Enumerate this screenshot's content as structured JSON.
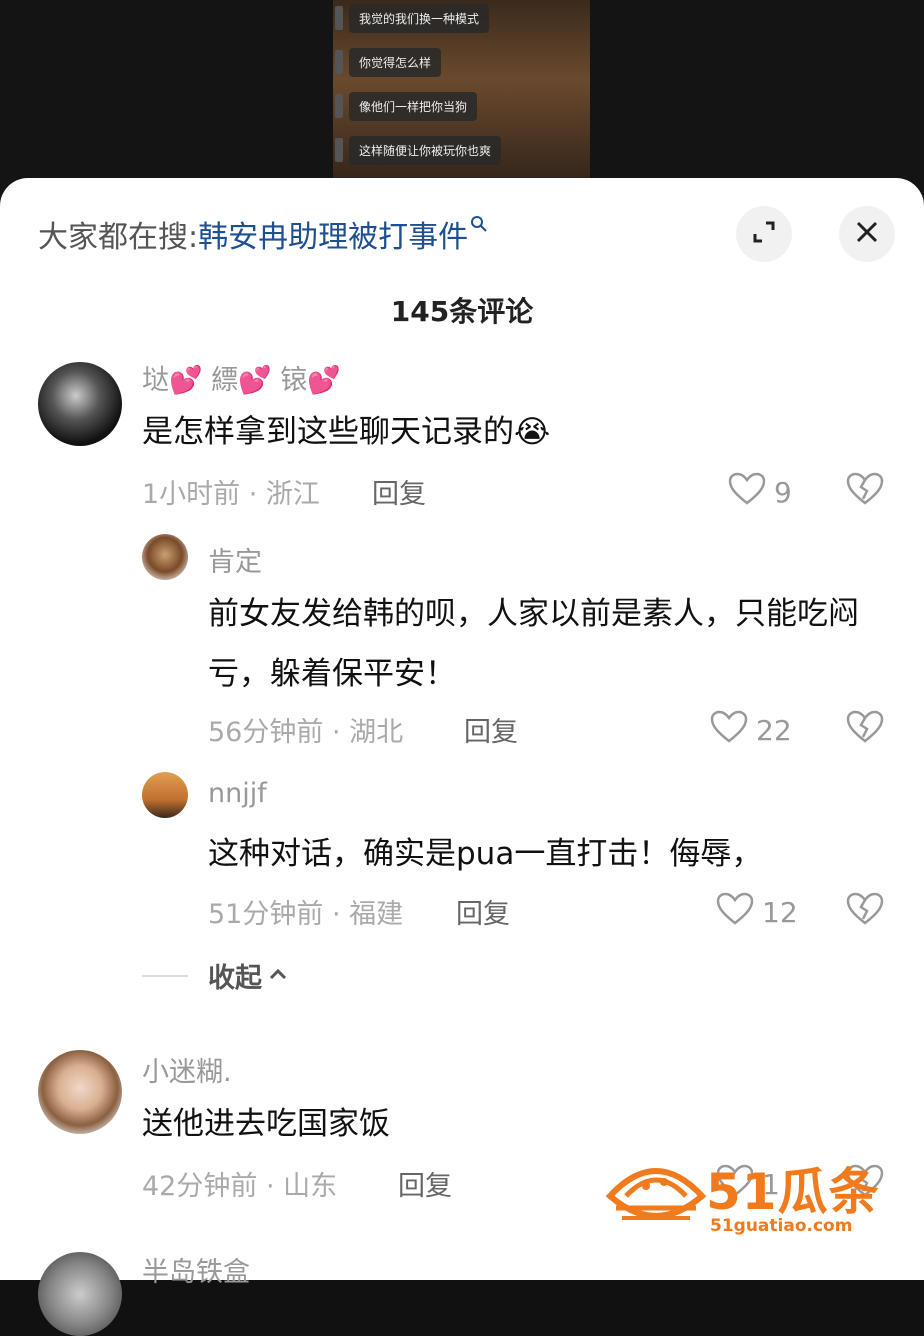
{
  "video": {
    "chat_lines": [
      "我觉的我们换一种模式",
      "你觉得怎么样",
      "像他们一样把你当狗",
      "这样随便让你被玩你也爽"
    ]
  },
  "header": {
    "search_prefix": "大家都在搜:",
    "search_query": "韩安冉助理被打事件",
    "comment_count": "145条评论"
  },
  "comments": [
    {
      "name": "垯💕 縹💕 锿💕",
      "text": "是怎样拿到这些聊天记录的😭",
      "meta": "1小时前 · 浙江",
      "reply": "回复",
      "likes": "9"
    },
    {
      "name": "肯定",
      "text": "前女友发给韩的呗，人家以前是素人，只能吃闷亏，躲着保平安！",
      "meta": "56分钟前 · 湖北",
      "reply": "回复",
      "likes": "22"
    },
    {
      "name": "nnjjf",
      "text": "这种对话，确实是pua一直打击！侮辱，",
      "meta": "51分钟前 · 福建",
      "reply": "回复",
      "likes": "12"
    },
    {
      "name": "小迷糊.",
      "text": "送他进去吃国家饭",
      "meta": "42分钟前 · 山东",
      "reply": "回复",
      "likes": "1"
    },
    {
      "name": "半岛铁盒"
    }
  ],
  "collapse_label": "收起",
  "watermark": {
    "brand": "51瓜条",
    "url": "51guatiao.com"
  },
  "colors": {
    "link_blue": "#1d4f91",
    "watermark_orange": "#f07a1c"
  },
  "icons": [
    "expand-icon",
    "close-icon",
    "heart-icon",
    "broken-heart-icon",
    "chevron-up-icon",
    "search-icon"
  ]
}
